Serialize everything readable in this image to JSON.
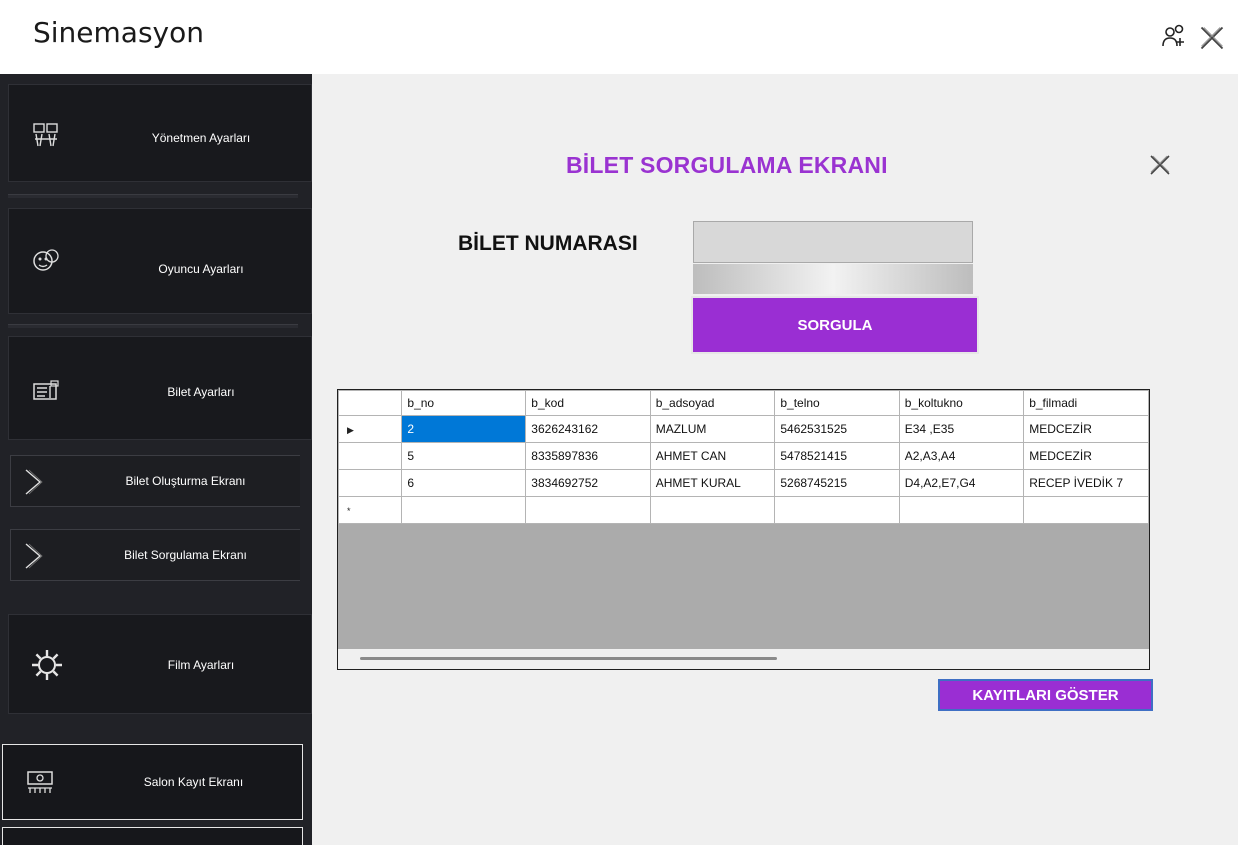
{
  "app": {
    "title": "Sinemasyon",
    "icons": {
      "users": "user-add-icon",
      "close": "close-icon"
    }
  },
  "sidebar": {
    "items": [
      {
        "label": "Yönetmen  Ayarları",
        "icon": "director-icon"
      },
      {
        "label": "Oyuncu Ayarları",
        "icon": "actor-icon"
      },
      {
        "label": "Bilet Ayarları",
        "icon": "ticket-icon"
      },
      {
        "label": "Bilet Oluşturma Ekranı",
        "icon": "chevron-right-icon"
      },
      {
        "label": "Bilet Sorgulama Ekranı",
        "icon": "chevron-right-icon"
      },
      {
        "label": "Film Ayarları",
        "icon": "gear-icon"
      },
      {
        "label": "Salon Kayıt Ekranı",
        "icon": "hall-icon"
      }
    ]
  },
  "main": {
    "title": "BİLET SORGULAMA EKRANI",
    "ticket_label": "BİLET NUMARASI",
    "ticket_input": {
      "value": "",
      "placeholder": ""
    },
    "query_button": "SORGULA",
    "show_records_button": "KAYITLARI GÖSTER",
    "grid": {
      "columns": [
        "b_no",
        "b_kod",
        "b_adsoyad",
        "b_telno",
        "b_koltukno",
        "b_filmadi"
      ],
      "rows": [
        [
          "2",
          "3626243162",
          "MAZLUM",
          "5462531525",
          "E34 ,E35",
          "MEDCEZİR"
        ],
        [
          "5",
          "8335897836",
          "AHMET CAN",
          "5478521415",
          "A2,A3,A4",
          "MEDCEZİR"
        ],
        [
          "6",
          "3834692752",
          "AHMET KURAL",
          "5268745215",
          "D4,A2,E7,G4",
          "RECEP İVEDİK 7"
        ]
      ],
      "current_row_marker": "▶",
      "new_row_marker": "*"
    }
  },
  "colors": {
    "accent_purple": "#9a2ed3",
    "title_purple": "#9a33d1",
    "sidebar_bg": "#212227",
    "selection_blue": "#0078d7"
  }
}
